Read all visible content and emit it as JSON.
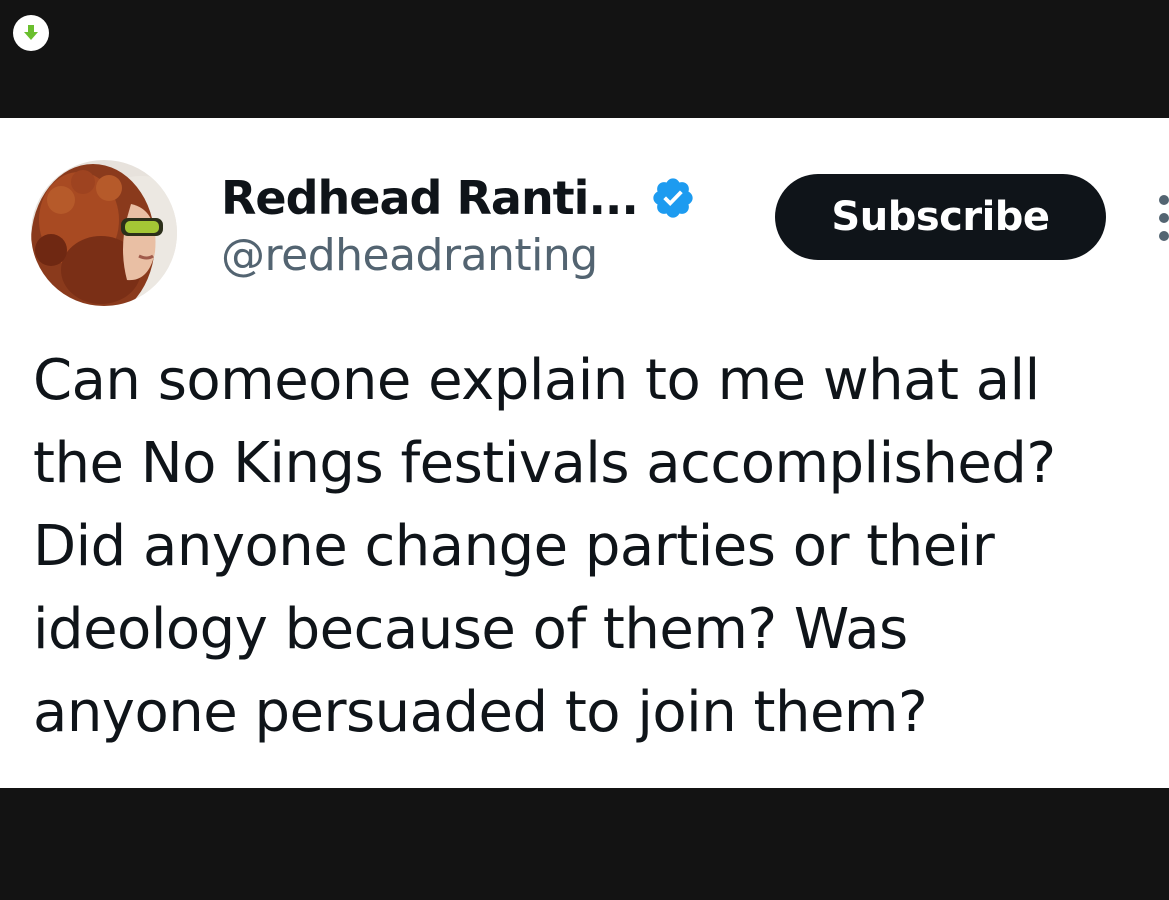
{
  "toolbar": {
    "download_icon": "download-arrow-icon",
    "download_color": "#6abf2e"
  },
  "tweet": {
    "author": {
      "display_name": "Redhead Ranti...",
      "handle": "@redheadranting",
      "verified": true,
      "verified_icon": "verified-badge-icon",
      "verified_color": "#1d9bf0"
    },
    "subscribe_label": "Subscribe",
    "more_icon": "more-options-icon",
    "text_lines": [
      "Can someone explain to me what all",
      "the No Kings festivals accomplished?",
      "Did anyone change parties or their",
      "ideology because of them? Was",
      "anyone persuaded to join them?"
    ]
  },
  "colors": {
    "background": "#131313",
    "card": "#ffffff",
    "text": "#0f1419",
    "handle": "#536471",
    "button": "#0f1419"
  }
}
